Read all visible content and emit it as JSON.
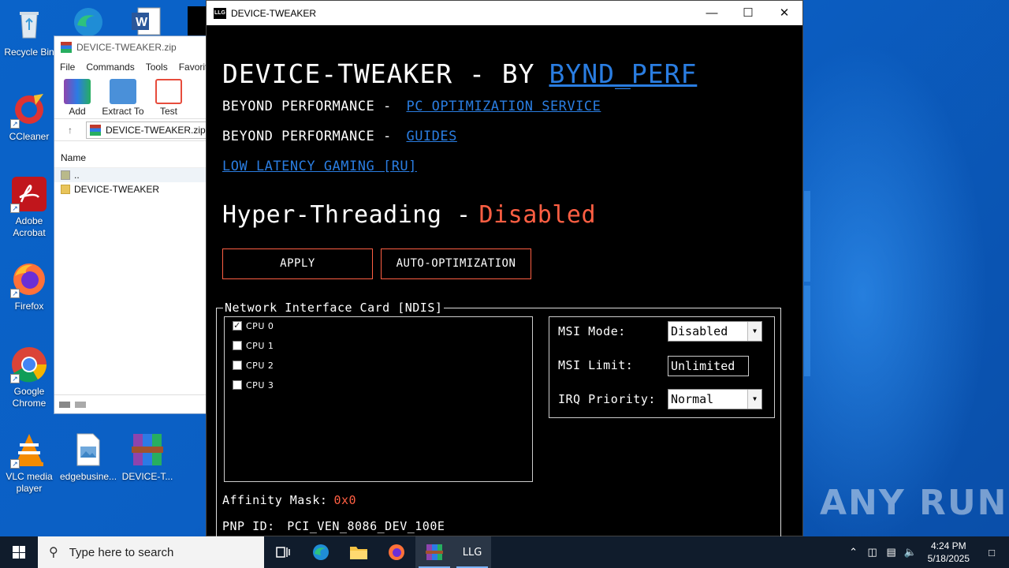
{
  "desktop": {
    "icons": [
      {
        "label": "Recycle Bin",
        "icon": "recycle-bin-icon"
      },
      {
        "label": "CCleaner",
        "icon": "ccleaner-icon"
      },
      {
        "label": "Adobe Acrobat",
        "icon": "adobe-acrobat-icon"
      },
      {
        "label": "Firefox",
        "icon": "firefox-icon"
      },
      {
        "label": "Google Chrome",
        "icon": "chrome-icon"
      },
      {
        "label": "VLC media player",
        "icon": "vlc-icon"
      },
      {
        "label": "edgebusine...",
        "icon": "image-file-icon"
      },
      {
        "label": "DEVICE-T...",
        "icon": "winrar-archive-icon"
      }
    ],
    "watermark": "ANY RUN"
  },
  "winrar": {
    "title": "DEVICE-TWEAKER.zip",
    "menu": [
      "File",
      "Commands",
      "Tools",
      "Favorit"
    ],
    "toolbar": [
      {
        "label": "Add",
        "color": "#c0392b"
      },
      {
        "label": "Extract To",
        "color": "#4a90d9"
      },
      {
        "label": "Test",
        "color": "#e74c3c"
      }
    ],
    "path": "DEVICE-TWEAKER.zip",
    "column_name": "Name",
    "rows": [
      "..",
      "DEVICE-TWEAKER"
    ]
  },
  "app": {
    "window_title": "DEVICE-TWEAKER",
    "logo": "LLG",
    "heading": "DEVICE-TWEAKER - BY",
    "heading_link": "BYND_PERF",
    "line1_prefix": "BEYOND PERFORMANCE -",
    "line1_link": "PC OPTIMIZATION SERVICE",
    "line2_prefix": "BEYOND PERFORMANCE -",
    "line2_link": "GUIDES",
    "line3_link": "LOW LATENCY GAMING [RU]",
    "ht_label": "Hyper-Threading -",
    "ht_value": "Disabled",
    "apply_button": "APPLY",
    "auto_button": "AUTO-OPTIMIZATION",
    "group_title": "Network Interface Card [NDIS]",
    "cpus": [
      {
        "label": "CPU 0",
        "checked": true
      },
      {
        "label": "CPU 1",
        "checked": false
      },
      {
        "label": "CPU 2",
        "checked": false
      },
      {
        "label": "CPU 3",
        "checked": false
      }
    ],
    "msi_mode_label": "MSI Mode:",
    "msi_mode_value": "Disabled",
    "msi_limit_label": "MSI Limit:",
    "msi_limit_value": "Unlimited",
    "irq_label": "IRQ Priority:",
    "irq_value": "Normal",
    "affinity_label": "Affinity Mask:",
    "affinity_value": "0x0",
    "pnp_label": "PNP ID:",
    "pnp_value": "PCI_VEN_8086_DEV_100E",
    "accent_color": "#ff5f43",
    "link_color": "#2a7de1"
  },
  "taskbar": {
    "search_placeholder": "Type here to search",
    "time": "4:24 PM",
    "date": "5/18/2025",
    "active_app": "LLG"
  }
}
